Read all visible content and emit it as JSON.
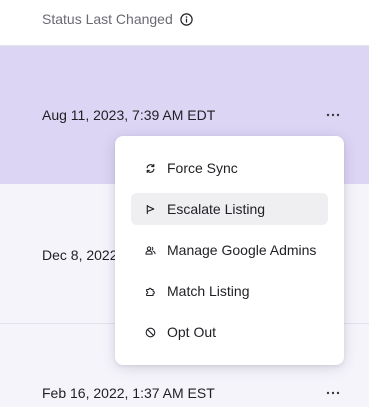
{
  "header": {
    "column_label": "Status Last Changed",
    "info_icon": "info-icon"
  },
  "rows": [
    {
      "date": "Aug 11, 2023, 7:39 AM EDT",
      "more_icon": "ellipsis-icon"
    },
    {
      "date": "Dec 8, 2022"
    },
    {
      "date": "Feb 16, 2022, 1:37 AM EST",
      "more_icon": "ellipsis-icon"
    }
  ],
  "menu": {
    "items": [
      {
        "label": "Force Sync",
        "icon": "sync-icon"
      },
      {
        "label": "Escalate Listing",
        "icon": "flag-icon"
      },
      {
        "label": "Manage Google Admins",
        "icon": "users-icon"
      },
      {
        "label": "Match Listing",
        "icon": "puzzle-icon"
      },
      {
        "label": "Opt Out",
        "icon": "block-icon"
      }
    ],
    "hovered_index": 1
  },
  "colors": {
    "selected_row": "#ddd5f4",
    "row_background": "#f6f4fb",
    "menu_hover": "#efeef1",
    "text": "#1f1f24",
    "muted_text": "#6b6a73"
  }
}
